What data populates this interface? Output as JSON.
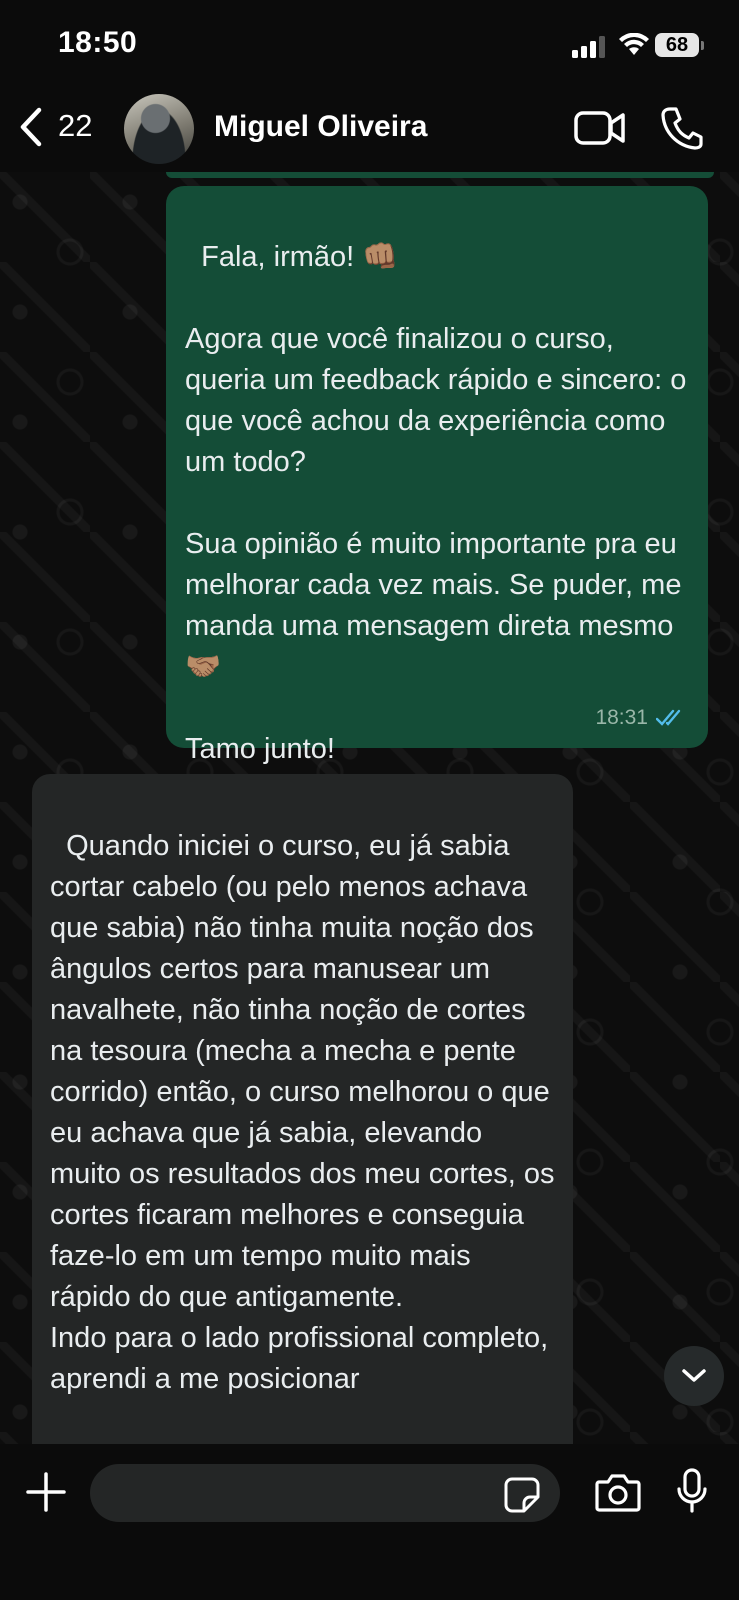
{
  "status_bar": {
    "time": "18:50",
    "battery": "68"
  },
  "header": {
    "unread_count": "22",
    "contact_name": "Miguel Oliveira"
  },
  "messages": [
    {
      "direction": "outgoing",
      "text": "Fala, irmão! 👊🏽\n\nAgora que você finalizou o curso, queria um feedback rápido e sincero: o que você achou da experiência como um todo?\n\nSua opinião é muito importante pra eu melhorar cada vez mais. Se puder, me manda uma mensagem direta mesmo 🤝🏽\n\nTamo junto!",
      "time": "18:31",
      "status": "read",
      "tick_color": "#53bdeb"
    },
    {
      "direction": "incoming",
      "text": "Quando iniciei o curso, eu já sabia cortar cabelo (ou pelo menos achava que sabia) não tinha muita noção dos ângulos certos para manusear um navalhete, não tinha noção de cortes na tesoura (mecha a mecha e pente corrido) então, o curso melhorou o que eu achava que já sabia, elevando muito os resultados dos meu cortes, os cortes ficaram melhores e conseguia faze-lo em um tempo muito mais rápido do que antigamente.\nIndo para o lado profissional completo, aprendi a me posicionar"
    }
  ],
  "composer": {
    "placeholder": ""
  },
  "colors": {
    "outgoing_bubble": "#144d37",
    "incoming_bubble": "#242626",
    "background": "#0b0b0b"
  }
}
